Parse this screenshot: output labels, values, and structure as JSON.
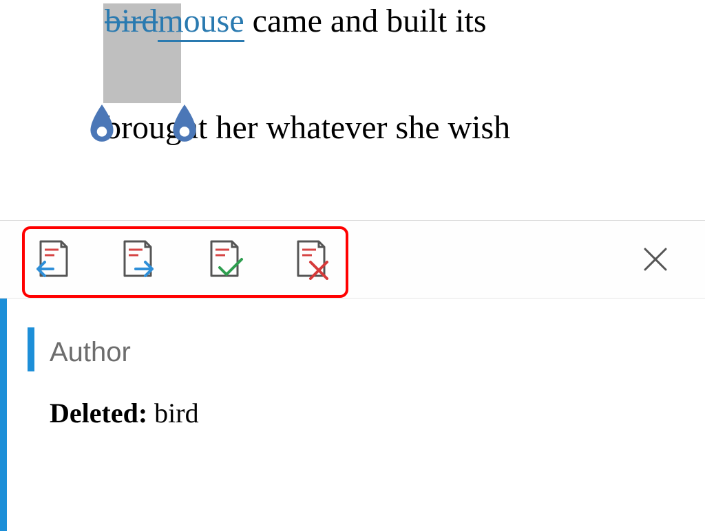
{
  "document": {
    "line1": {
      "deleted": "bird",
      "inserted": "mouse",
      "rest": " came and built its"
    },
    "line2": "brought her whatever she wish"
  },
  "toolbar": {
    "prev": "previous-change",
    "next": "next-change",
    "accept": "accept-change",
    "reject": "reject-change",
    "close": "close"
  },
  "revision": {
    "author": "Author",
    "change_label": "Deleted:",
    "change_text": " bird"
  },
  "colors": {
    "trackchange": "#2a7ab0",
    "highlight_fill": "#bfbfbf",
    "handle_fill": "#4b77b7",
    "accent": "#1d8fd8",
    "annotation_box": "#ff0000"
  }
}
